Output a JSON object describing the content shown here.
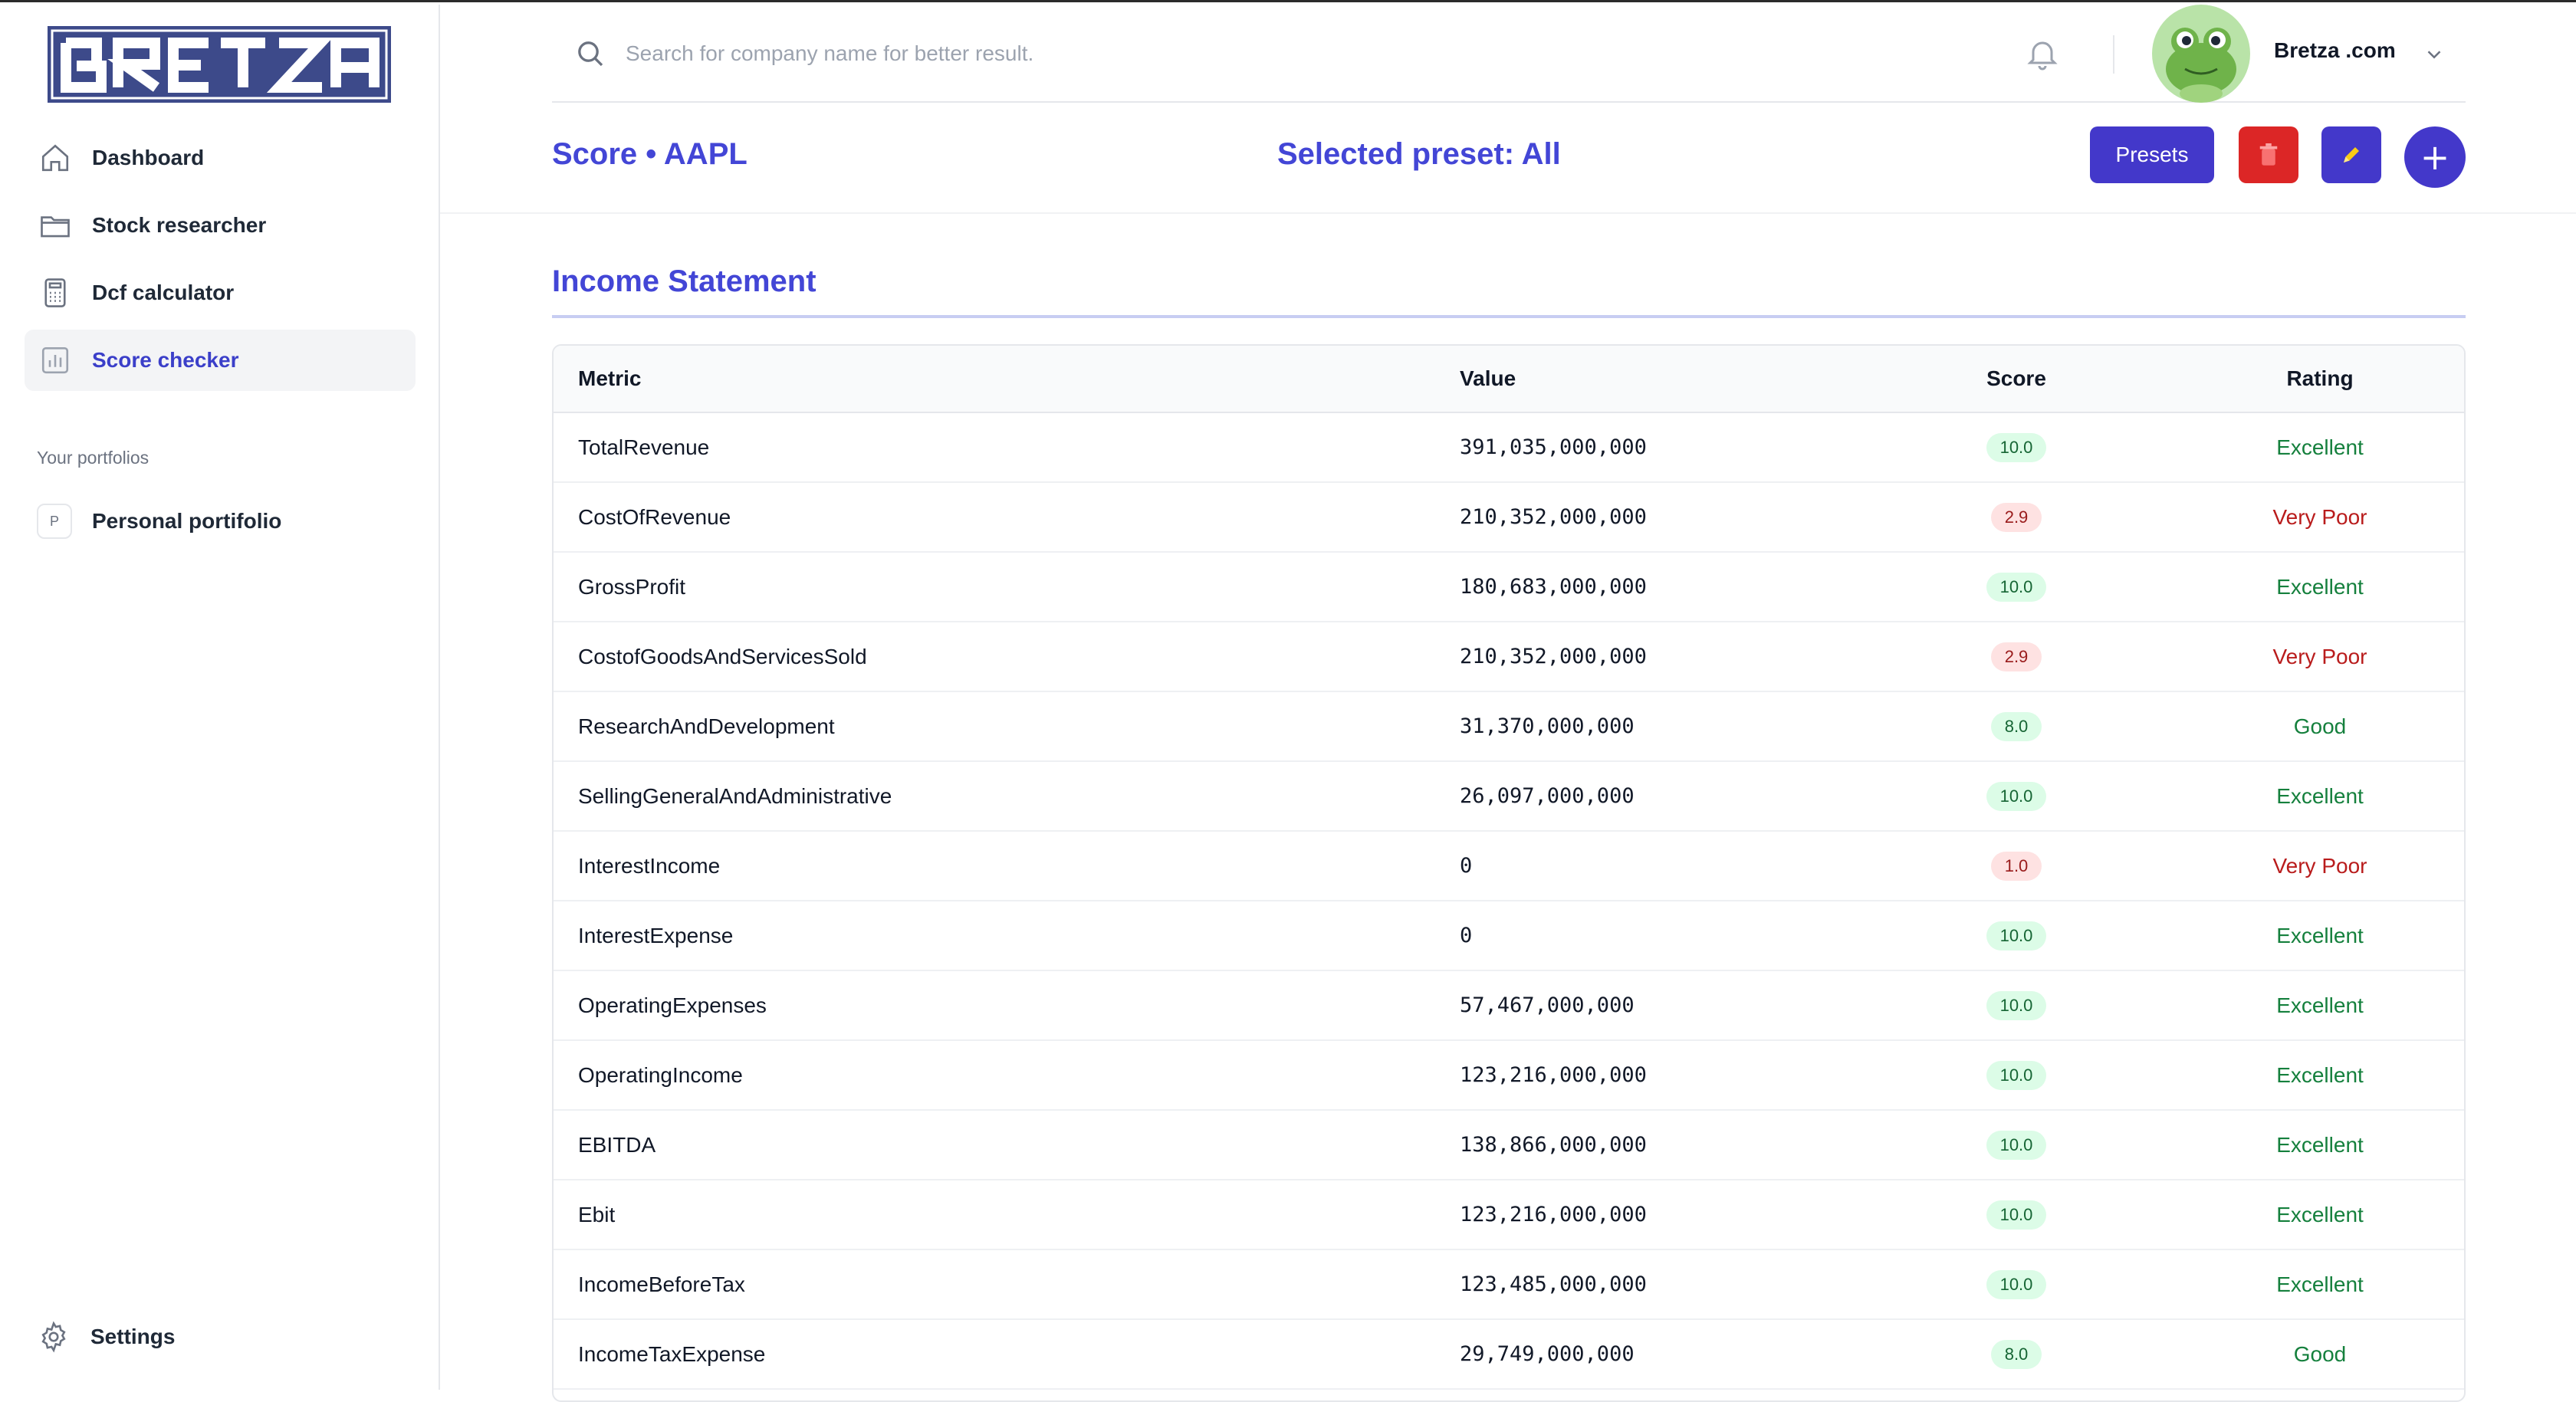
{
  "brand": {
    "logo_text": "BRETZA"
  },
  "sidebar": {
    "items": [
      {
        "label": "Dashboard",
        "icon": "home-icon",
        "active": false
      },
      {
        "label": "Stock researcher",
        "icon": "folder-icon",
        "active": false
      },
      {
        "label": "Dcf calculator",
        "icon": "calculator-icon",
        "active": false
      },
      {
        "label": "Score checker",
        "icon": "chart-bar-icon",
        "active": true
      }
    ],
    "portfolios_label": "Your portfolios",
    "portfolios": [
      {
        "badge": "P",
        "label": "Personal portifolio"
      }
    ],
    "settings_label": "Settings"
  },
  "topbar": {
    "search_placeholder": "Search for company name for better result.",
    "user_name": "Bretza .com"
  },
  "header": {
    "title": "Score • AAPL",
    "preset": "Selected preset: All",
    "presets_button": "Presets",
    "add_button": "+"
  },
  "section": {
    "title": "Income Statement"
  },
  "table": {
    "columns": [
      "Metric",
      "Value",
      "Score",
      "Rating"
    ],
    "rows": [
      {
        "metric": "TotalRevenue",
        "value": "391,035,000,000",
        "score": "10.0",
        "rating": "Excellent",
        "tone": "good"
      },
      {
        "metric": "CostOfRevenue",
        "value": "210,352,000,000",
        "score": "2.9",
        "rating": "Very Poor",
        "tone": "bad"
      },
      {
        "metric": "GrossProfit",
        "value": "180,683,000,000",
        "score": "10.0",
        "rating": "Excellent",
        "tone": "good"
      },
      {
        "metric": "CostofGoodsAndServicesSold",
        "value": "210,352,000,000",
        "score": "2.9",
        "rating": "Very Poor",
        "tone": "bad"
      },
      {
        "metric": "ResearchAndDevelopment",
        "value": "31,370,000,000",
        "score": "8.0",
        "rating": "Good",
        "tone": "good"
      },
      {
        "metric": "SellingGeneralAndAdministrative",
        "value": "26,097,000,000",
        "score": "10.0",
        "rating": "Excellent",
        "tone": "good"
      },
      {
        "metric": "InterestIncome",
        "value": "0",
        "score": "1.0",
        "rating": "Very Poor",
        "tone": "bad"
      },
      {
        "metric": "InterestExpense",
        "value": "0",
        "score": "10.0",
        "rating": "Excellent",
        "tone": "good"
      },
      {
        "metric": "OperatingExpenses",
        "value": "57,467,000,000",
        "score": "10.0",
        "rating": "Excellent",
        "tone": "good"
      },
      {
        "metric": "OperatingIncome",
        "value": "123,216,000,000",
        "score": "10.0",
        "rating": "Excellent",
        "tone": "good"
      },
      {
        "metric": "EBITDA",
        "value": "138,866,000,000",
        "score": "10.0",
        "rating": "Excellent",
        "tone": "good"
      },
      {
        "metric": "Ebit",
        "value": "123,216,000,000",
        "score": "10.0",
        "rating": "Excellent",
        "tone": "good"
      },
      {
        "metric": "IncomeBeforeTax",
        "value": "123,485,000,000",
        "score": "10.0",
        "rating": "Excellent",
        "tone": "good"
      },
      {
        "metric": "IncomeTaxExpense",
        "value": "29,749,000,000",
        "score": "8.0",
        "rating": "Good",
        "tone": "good"
      }
    ]
  },
  "colors": {
    "accent": "#4338ca",
    "title": "#4346d6",
    "danger": "#dc2626",
    "good": "#15803d",
    "bad": "#b91c1c"
  }
}
